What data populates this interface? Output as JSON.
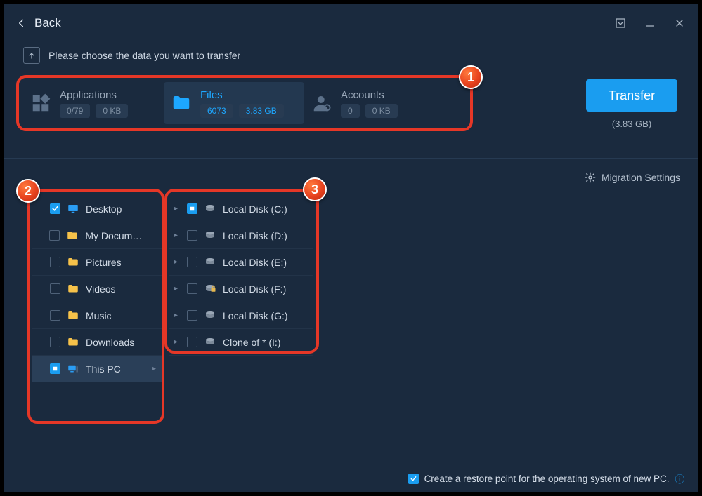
{
  "titlebar": {
    "back_label": "Back"
  },
  "instruction": "Please choose the data you want to transfer",
  "tabs": {
    "apps": {
      "title": "Applications",
      "count": "0/79",
      "size": "0 KB",
      "active": false
    },
    "files": {
      "title": "Files",
      "count": "6073",
      "size": "3.83 GB",
      "active": true
    },
    "accounts": {
      "title": "Accounts",
      "count": "0",
      "size": "0 KB",
      "active": false
    }
  },
  "transfer": {
    "button": "Transfer",
    "size": "(3.83 GB)"
  },
  "migration_settings_label": "Migration Settings",
  "folders": [
    {
      "label": "Desktop",
      "checked": "on",
      "icon": "monitor",
      "selected": false,
      "has_sub": false
    },
    {
      "label": "My Documents",
      "checked": "off",
      "icon": "folder",
      "selected": false,
      "has_sub": false
    },
    {
      "label": "Pictures",
      "checked": "off",
      "icon": "folder",
      "selected": false,
      "has_sub": false
    },
    {
      "label": "Videos",
      "checked": "off",
      "icon": "folder",
      "selected": false,
      "has_sub": false
    },
    {
      "label": "Music",
      "checked": "off",
      "icon": "folder",
      "selected": false,
      "has_sub": false
    },
    {
      "label": "Downloads",
      "checked": "off",
      "icon": "folder",
      "selected": false,
      "has_sub": false
    },
    {
      "label": "This PC",
      "checked": "partial",
      "icon": "pc",
      "selected": true,
      "has_sub": true
    }
  ],
  "disks": [
    {
      "label": "Local Disk (C:)",
      "checked": "partial",
      "icon": "disk",
      "expandable": true
    },
    {
      "label": "Local Disk (D:)",
      "checked": "off",
      "icon": "disk",
      "expandable": true
    },
    {
      "label": "Local Disk (E:)",
      "checked": "off",
      "icon": "disk",
      "expandable": true
    },
    {
      "label": "Local Disk (F:)",
      "checked": "off",
      "icon": "disk-lock",
      "expandable": true
    },
    {
      "label": "Local Disk (G:)",
      "checked": "off",
      "icon": "disk",
      "expandable": true
    },
    {
      "label": "Clone of * (I:)",
      "checked": "off",
      "icon": "disk",
      "expandable": true
    }
  ],
  "annotations": {
    "b1": "1",
    "b2": "2",
    "b3": "3"
  },
  "footer": {
    "restore_label": "Create a restore point for the operating system of new PC.",
    "restore_checked": true
  }
}
